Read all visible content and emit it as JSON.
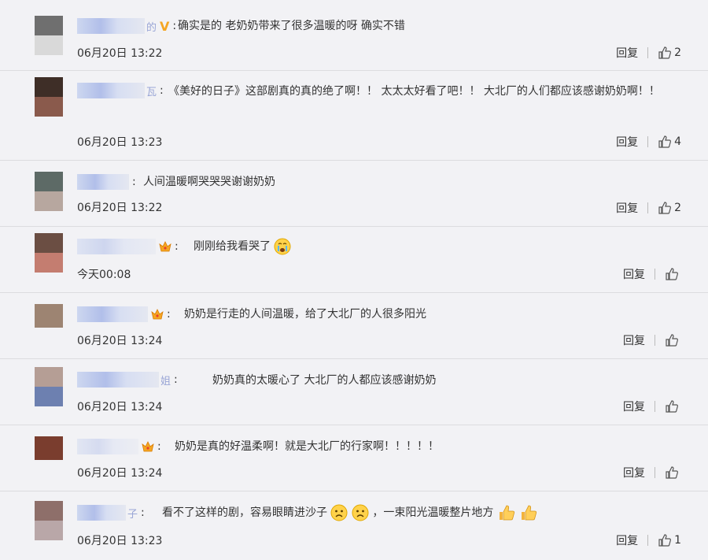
{
  "comments": [
    {
      "name_tail": "的",
      "badge": "v",
      "text": "确实是的 老奶奶带来了很多温暖的呀 确实不错",
      "time": "06月20日 13:22",
      "reply": "回复",
      "likes": "2",
      "avatar": [
        "#6f6f6f",
        "#d9d9d9"
      ]
    },
    {
      "name_tail": "瓦",
      "badge": "",
      "text": "《美好的日子》这部剧真的真的绝了啊！！ 太太太好看了吧！！ 大北厂的人们都应该感谢奶奶啊！！",
      "time": "06月20日 13:23",
      "reply": "回复",
      "likes": "4",
      "avatar": [
        "#3e2e27",
        "#8a5a4c"
      ]
    },
    {
      "name_tail": "",
      "badge": "",
      "text": "人间温暖啊哭哭哭谢谢奶奶",
      "time": "06月20日 13:22",
      "reply": "回复",
      "likes": "2",
      "avatar": [
        "#5d6a66",
        "#b7a79f"
      ]
    },
    {
      "name_tail": "",
      "badge": "crown",
      "text": "刚刚给我看哭了",
      "time": "今天00:08",
      "reply": "回复",
      "likes": "",
      "avatar": [
        "#6b4e43",
        "#c47d70"
      ]
    },
    {
      "name_tail": "",
      "badge": "crown",
      "text": "奶奶是行走的人间温暖，给了大北厂的人很多阳光",
      "time": "06月20日 13:24",
      "reply": "回复",
      "likes": "",
      "avatar": [
        "#9d8472",
        "#f0f0f0"
      ]
    },
    {
      "name_tail": "姐",
      "badge": "",
      "text": "奶奶真的太暖心了 大北厂的人都应该感谢奶奶",
      "time": "06月20日 13:24",
      "reply": "回复",
      "likes": "",
      "avatar": [
        "#b59e95",
        "#6d80b0"
      ]
    },
    {
      "name_tail": "",
      "badge": "crown",
      "text": "奶奶是真的好温柔啊！就是大北厂的行家啊！！！！！",
      "time": "06月20日 13:24",
      "reply": "回复",
      "likes": "",
      "avatar": [
        "#7a3d2e",
        "#f0f0f0"
      ]
    },
    {
      "name_tail": "子",
      "badge": "",
      "text_parts": [
        "看不了这样的剧，容易眼睛进沙子",
        "，一束阳光温暖整片地方"
      ],
      "time": "06月20日 13:23",
      "reply": "回复",
      "likes": "1",
      "avatar": [
        "#8e6f6a",
        "#b9a7a8"
      ]
    }
  ],
  "icons": {
    "verified": "verified-v-icon",
    "crown": "crown-icon",
    "like": "thumbs-up-icon",
    "cry": "crying-emoji-icon",
    "sad": "sad-emoji-icon",
    "thumb": "thumbs-up-emoji-icon"
  }
}
